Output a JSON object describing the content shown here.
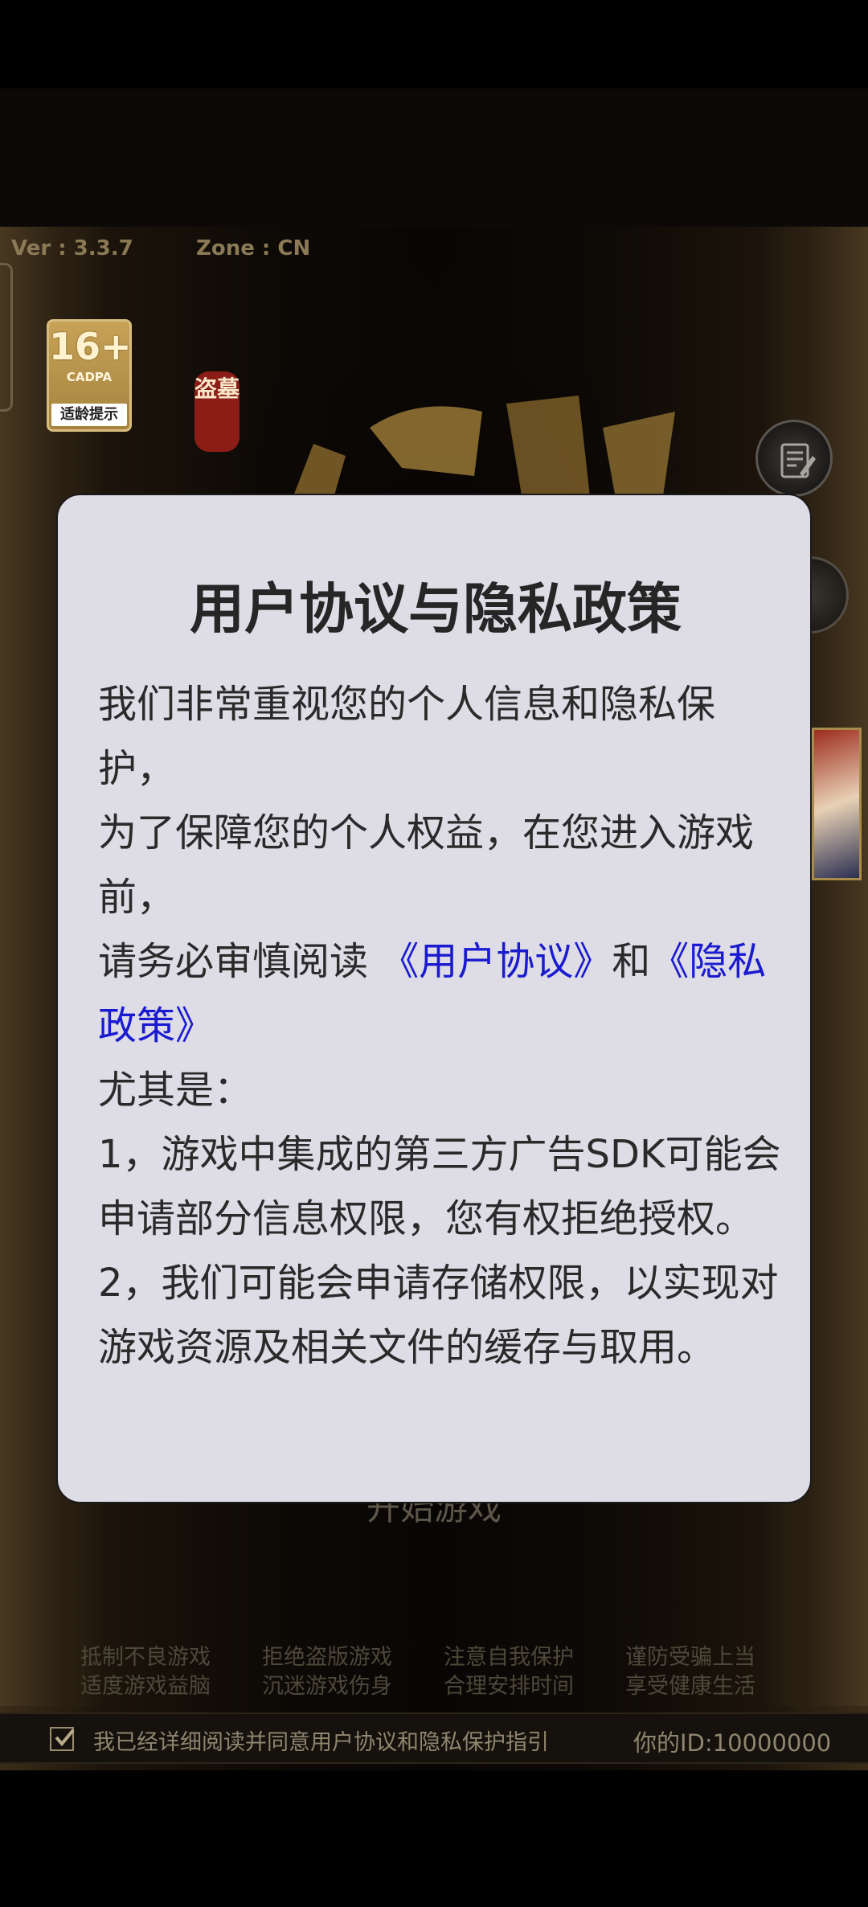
{
  "game": {
    "version": "Ver : 3.3.7",
    "zone": "Zone : CN",
    "age_badge": {
      "age": "16+",
      "org": "CADPA",
      "tip": "适龄提示"
    },
    "logo_seal": "盗墓",
    "start_label": "开始游戏",
    "warnings": [
      "抵制不良游戏",
      "拒绝盗版游戏",
      "注意自我保护",
      "谨防受骗上当",
      "适度游戏益脑",
      "沉迷游戏伤身",
      "合理安排时间",
      "享受健康生活"
    ],
    "agree_text": "我已经详细阅读并同意用户协议和隐私保护指引",
    "user_id": "你的ID:10000000",
    "agree_checked": true
  },
  "modal": {
    "title": "用户协议与隐私政策",
    "line1": "我们非常重视您的个人信息和隐私保护，",
    "line2": "为了保障您的个人权益，在您进入游戏前，",
    "line3_prefix": "请务必审慎阅读 ",
    "user_agreement_link": "《用户协议》",
    "and_text": "和",
    "privacy_link": "《隐私政策》",
    "line4": "尤其是：",
    "item1": "1，游戏中集成的第三方广告SDK可能会申请部分信息权限，您有权拒绝授权。",
    "item2": "2，我们可能会申请存储权限，以实现对游戏资源及相关文件的缓存与取用。"
  },
  "colors": {
    "modal_bg": "#dedde6",
    "link": "#1a1ad0",
    "gold": "#c7a257"
  }
}
